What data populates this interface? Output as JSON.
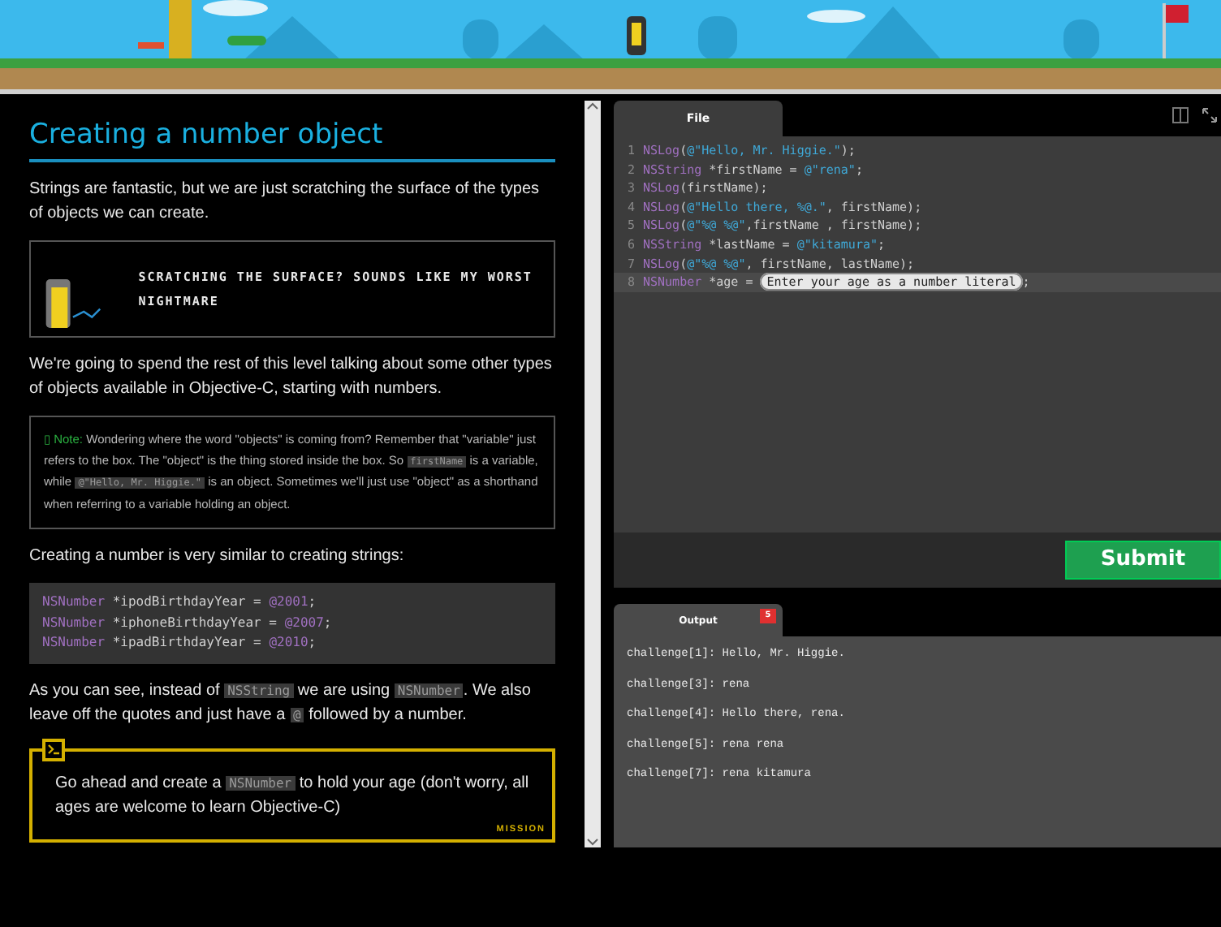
{
  "lesson": {
    "title": "Creating a number object",
    "intro": "Strings are fantastic, but we are just scratching the surface of the types of objects we can create.",
    "quote": "SCRATCHING THE SURFACE? SOUNDS LIKE MY WORST NIGHTMARE",
    "paragraph": "We're going to spend the rest of this level talking about some other types of objects available in Objective-C, starting with numbers.",
    "note": {
      "icon": "▯",
      "label": "Note:",
      "parts": [
        {
          "kind": "text",
          "text": "Wondering where the word \"objects\" is coming from? Remember that \"variable\" just refers to the box. The \"object\" is the thing stored inside the box. So "
        },
        {
          "kind": "code",
          "text": "firstName"
        },
        {
          "kind": "text",
          "text": " is a variable, while "
        },
        {
          "kind": "code",
          "text": "@\"Hello, Mr. Higgie.\""
        },
        {
          "kind": "text",
          "text": " is an object. Sometimes we'll just use \"object\" as a shorthand when referring to a variable holding an object."
        }
      ]
    },
    "lead": "Creating a number is very similar to creating strings:",
    "code_block": [
      [
        {
          "kind": "type",
          "text": "NSNumber"
        },
        {
          "kind": "plain",
          "text": " *ipodBirthdayYear = "
        },
        {
          "kind": "type",
          "text": "@2001"
        },
        {
          "kind": "plain",
          "text": ";"
        }
      ],
      [
        {
          "kind": "type",
          "text": "NSNumber"
        },
        {
          "kind": "plain",
          "text": " *iphoneBirthdayYear = "
        },
        {
          "kind": "type",
          "text": "@2007"
        },
        {
          "kind": "plain",
          "text": ";"
        }
      ],
      [
        {
          "kind": "type",
          "text": "NSNumber"
        },
        {
          "kind": "plain",
          "text": " *ipadBirthdayYear = "
        },
        {
          "kind": "type",
          "text": "@2010"
        },
        {
          "kind": "plain",
          "text": ";"
        }
      ]
    ],
    "explanation": [
      {
        "kind": "text",
        "text": "As you can see, instead of "
      },
      {
        "kind": "code",
        "text": "NSString"
      },
      {
        "kind": "text",
        "text": " we are using "
      },
      {
        "kind": "code",
        "text": "NSNumber"
      },
      {
        "kind": "text",
        "text": ". We also leave off the quotes and just have a "
      },
      {
        "kind": "code",
        "text": "@"
      },
      {
        "kind": "text",
        "text": " followed by a number."
      }
    ],
    "mission": {
      "parts": [
        {
          "kind": "text",
          "text": "Go ahead and create a "
        },
        {
          "kind": "code",
          "text": "NSNumber"
        },
        {
          "kind": "text",
          "text": " to hold your age (don't worry, all ages are welcome to learn Objective-C)"
        }
      ],
      "label": "MISSION"
    }
  },
  "editor": {
    "tab": "File",
    "lines": [
      {
        "number": "1",
        "selected": false,
        "tokens": [
          {
            "kind": "type",
            "text": "NSLog"
          },
          {
            "kind": "plain",
            "text": "("
          },
          {
            "kind": "string",
            "text": "@\"Hello, Mr. Higgie.\""
          },
          {
            "kind": "plain",
            "text": ");"
          }
        ]
      },
      {
        "number": "2",
        "selected": false,
        "tokens": [
          {
            "kind": "type",
            "text": "NSString"
          },
          {
            "kind": "plain",
            "text": " *firstName = "
          },
          {
            "kind": "string",
            "text": "@\"rena\""
          },
          {
            "kind": "plain",
            "text": ";"
          }
        ]
      },
      {
        "number": "3",
        "selected": false,
        "tokens": [
          {
            "kind": "type",
            "text": "NSLog"
          },
          {
            "kind": "plain",
            "text": "(firstName);"
          }
        ]
      },
      {
        "number": "4",
        "selected": false,
        "tokens": [
          {
            "kind": "type",
            "text": "NSLog"
          },
          {
            "kind": "plain",
            "text": "("
          },
          {
            "kind": "string",
            "text": "@\"Hello there, %@.\""
          },
          {
            "kind": "plain",
            "text": ", firstName);"
          }
        ]
      },
      {
        "number": "5",
        "selected": false,
        "tokens": [
          {
            "kind": "type",
            "text": "NSLog"
          },
          {
            "kind": "plain",
            "text": "("
          },
          {
            "kind": "string",
            "text": "@\"%@ %@\""
          },
          {
            "kind": "plain",
            "text": ",firstName , firstName);"
          }
        ]
      },
      {
        "number": "6",
        "selected": false,
        "tokens": [
          {
            "kind": "type",
            "text": "NSString"
          },
          {
            "kind": "plain",
            "text": " *lastName = "
          },
          {
            "kind": "string",
            "text": "@\"kitamura\""
          },
          {
            "kind": "plain",
            "text": ";"
          }
        ]
      },
      {
        "number": "7",
        "selected": false,
        "tokens": [
          {
            "kind": "type",
            "text": "NSLog"
          },
          {
            "kind": "plain",
            "text": "("
          },
          {
            "kind": "string",
            "text": "@\"%@ %@\""
          },
          {
            "kind": "plain",
            "text": ", firstName, lastName);"
          }
        ]
      },
      {
        "number": "8",
        "selected": true,
        "tokens": [
          {
            "kind": "type",
            "text": "NSNumber"
          },
          {
            "kind": "plain",
            "text": " *age = "
          },
          {
            "kind": "field",
            "text": "Enter your age as a number literal"
          },
          {
            "kind": "plain",
            "text": ";"
          }
        ]
      }
    ],
    "submit": "Submit"
  },
  "output": {
    "tab": "Output",
    "badge": "5",
    "lines": [
      "challenge[1]: Hello, Mr. Higgie.",
      "challenge[3]: rena",
      "challenge[4]: Hello there, rena.",
      "challenge[5]: rena rena",
      "challenge[7]: rena kitamura"
    ]
  }
}
